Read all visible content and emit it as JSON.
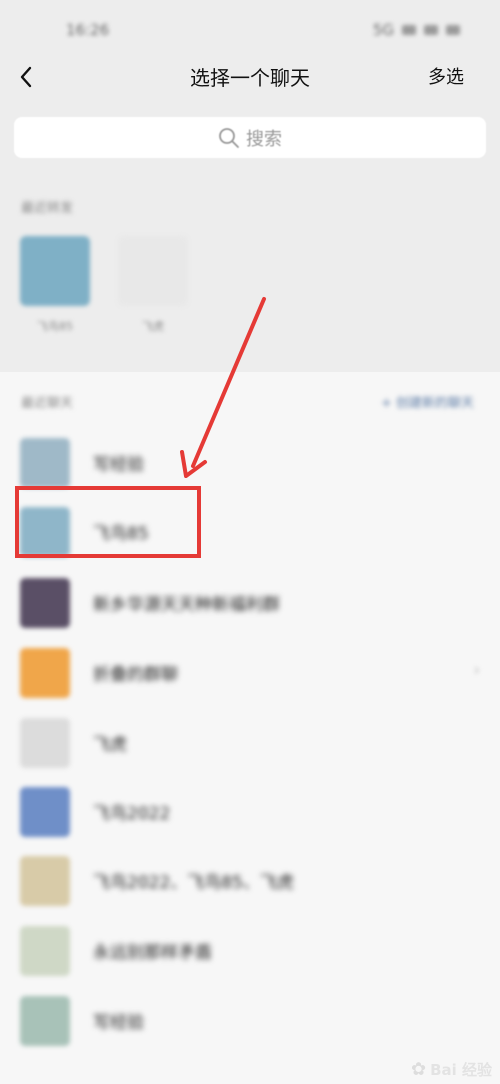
{
  "status_bar": {
    "time": "16:26",
    "indicators": "5G"
  },
  "header": {
    "title": "选择一个聊天",
    "multi_select_label": "多选"
  },
  "search": {
    "placeholder": "搜索"
  },
  "recent_contacts": {
    "label": "最近转发",
    "items": [
      {
        "name": "飞鸟85",
        "avatar_color": "#7fb0c6"
      },
      {
        "name": "飞虎",
        "avatar_color": "#e8e8e8"
      }
    ]
  },
  "recent_chats": {
    "label": "最近聊天",
    "create_label": "+ 创建新的聊天",
    "items": [
      {
        "name": "写经验",
        "avatar_color": "#9fb9c8"
      },
      {
        "name": "飞鸟85",
        "avatar_color": "#8fb6c9"
      },
      {
        "name": "新乡华源天天种新福利群",
        "avatar_color": "#5a4f66"
      },
      {
        "name": "折叠的群聊",
        "avatar_color": "#f0a64a",
        "has_chevron": true
      },
      {
        "name": "飞虎",
        "avatar_color": "#dcdcdc"
      },
      {
        "name": "飞鸟2022",
        "avatar_color": "#6f8fc8"
      },
      {
        "name": "飞鸟2022、飞鸟85、飞虎",
        "avatar_color": "#d8cba8"
      },
      {
        "name": "永远别那样矛盾",
        "avatar_color": "#cfd8c6"
      },
      {
        "name": "写经验",
        "avatar_color": "#a8c2b8"
      }
    ]
  },
  "annotation": {
    "color": "#e53a36"
  },
  "watermark": {
    "text": "Bai 经验"
  }
}
